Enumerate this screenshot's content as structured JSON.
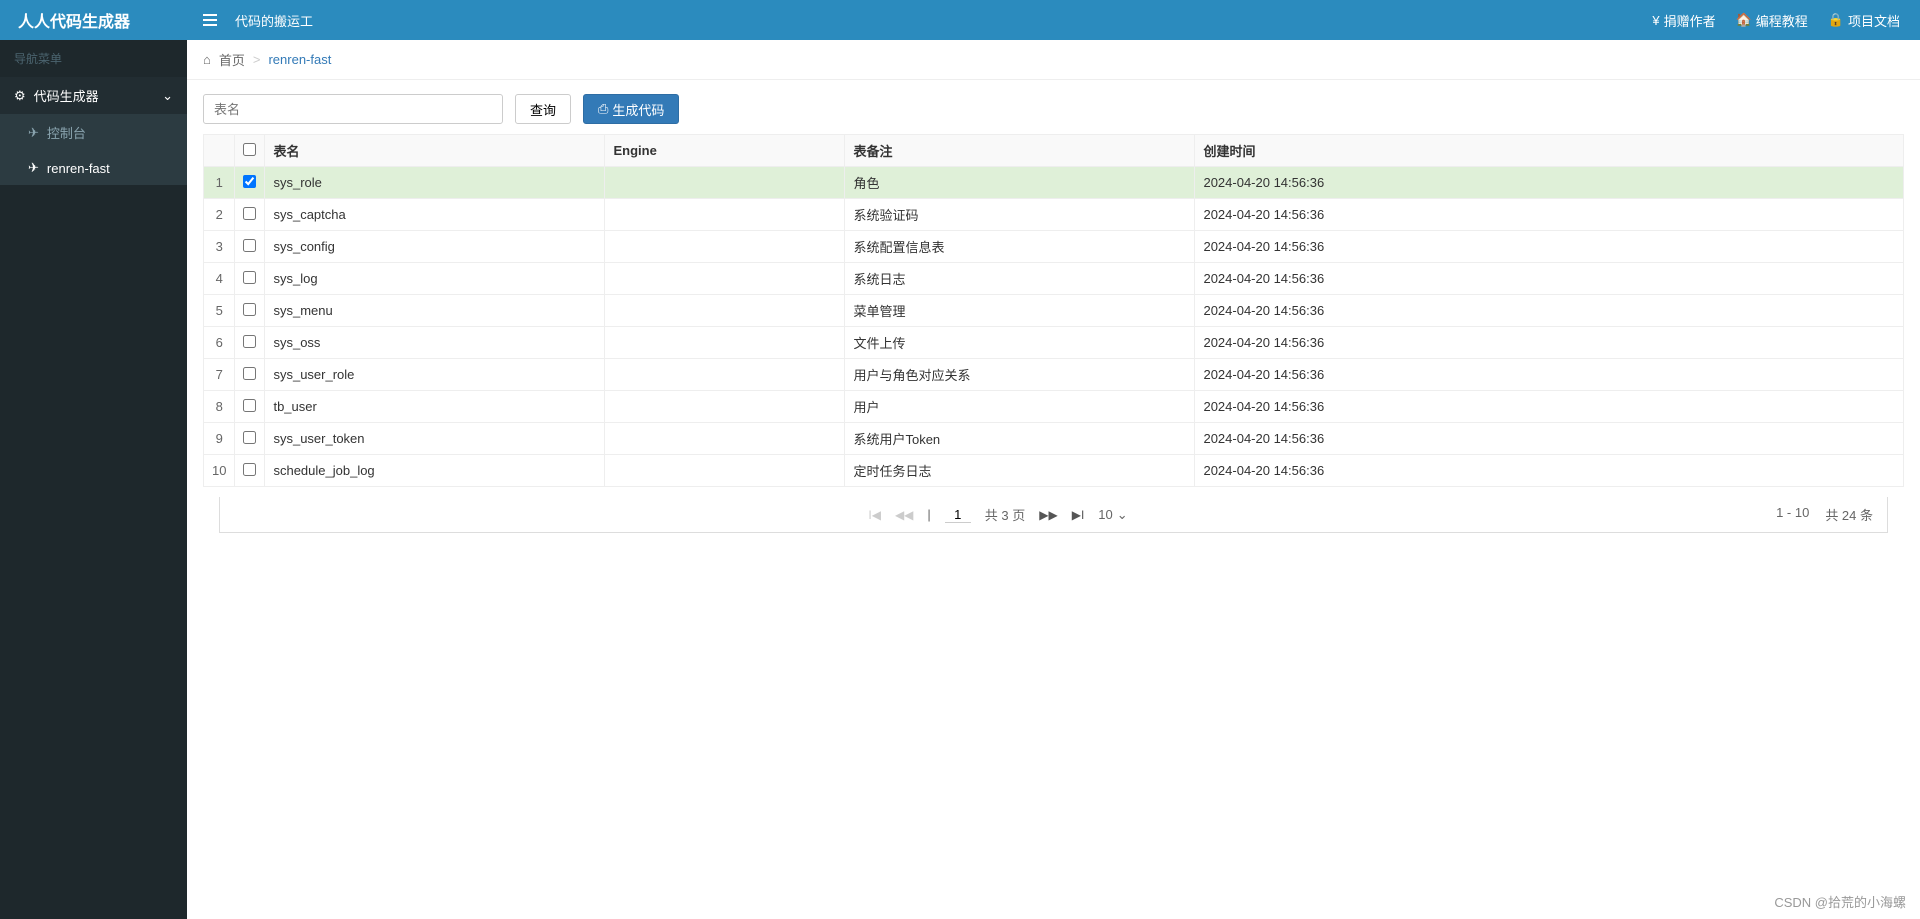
{
  "header": {
    "logo": "人人代码生成器",
    "subtitle": "代码的搬运工",
    "links": [
      {
        "icon": "¥",
        "label": "捐赠作者"
      },
      {
        "icon": "🏠",
        "label": "编程教程"
      },
      {
        "icon": "🔒",
        "label": "项目文档"
      }
    ]
  },
  "sidebar": {
    "title": "导航菜单",
    "parent": {
      "icon": "⚙",
      "label": "代码生成器"
    },
    "children": [
      {
        "icon": "✈",
        "label": "控制台",
        "active": false
      },
      {
        "icon": "✈",
        "label": "renren-fast",
        "active": true
      }
    ]
  },
  "breadcrumb": {
    "home_icon": "⌂",
    "home": "首页",
    "current": "renren-fast"
  },
  "toolbar": {
    "search_placeholder": "表名",
    "query_label": "查询",
    "generate_label": "生成代码",
    "generate_icon": "⎙"
  },
  "table": {
    "columns": {
      "name": "表名",
      "engine": "Engine",
      "comment": "表备注",
      "created": "创建时间"
    },
    "rows": [
      {
        "index": 1,
        "checked": true,
        "name": "sys_role",
        "engine": "",
        "comment": "角色",
        "created": "2024-04-20 14:56:36"
      },
      {
        "index": 2,
        "checked": false,
        "name": "sys_captcha",
        "engine": "",
        "comment": "系统验证码",
        "created": "2024-04-20 14:56:36"
      },
      {
        "index": 3,
        "checked": false,
        "name": "sys_config",
        "engine": "",
        "comment": "系统配置信息表",
        "created": "2024-04-20 14:56:36"
      },
      {
        "index": 4,
        "checked": false,
        "name": "sys_log",
        "engine": "",
        "comment": "系统日志",
        "created": "2024-04-20 14:56:36"
      },
      {
        "index": 5,
        "checked": false,
        "name": "sys_menu",
        "engine": "",
        "comment": "菜单管理",
        "created": "2024-04-20 14:56:36"
      },
      {
        "index": 6,
        "checked": false,
        "name": "sys_oss",
        "engine": "",
        "comment": "文件上传",
        "created": "2024-04-20 14:56:36"
      },
      {
        "index": 7,
        "checked": false,
        "name": "sys_user_role",
        "engine": "",
        "comment": "用户与角色对应关系",
        "created": "2024-04-20 14:56:36"
      },
      {
        "index": 8,
        "checked": false,
        "name": "tb_user",
        "engine": "",
        "comment": "用户",
        "created": "2024-04-20 14:56:36"
      },
      {
        "index": 9,
        "checked": false,
        "name": "sys_user_token",
        "engine": "",
        "comment": "系统用户Token",
        "created": "2024-04-20 14:56:36"
      },
      {
        "index": 10,
        "checked": false,
        "name": "schedule_job_log",
        "engine": "",
        "comment": "定时任务日志",
        "created": "2024-04-20 14:56:36"
      }
    ]
  },
  "pagination": {
    "current_page": "1",
    "total_pages_text": "共 3 页",
    "page_size": "10",
    "range_text": "1 - 10",
    "total_text": "共 24 条"
  },
  "watermark": "CSDN @拾荒的小海螺"
}
